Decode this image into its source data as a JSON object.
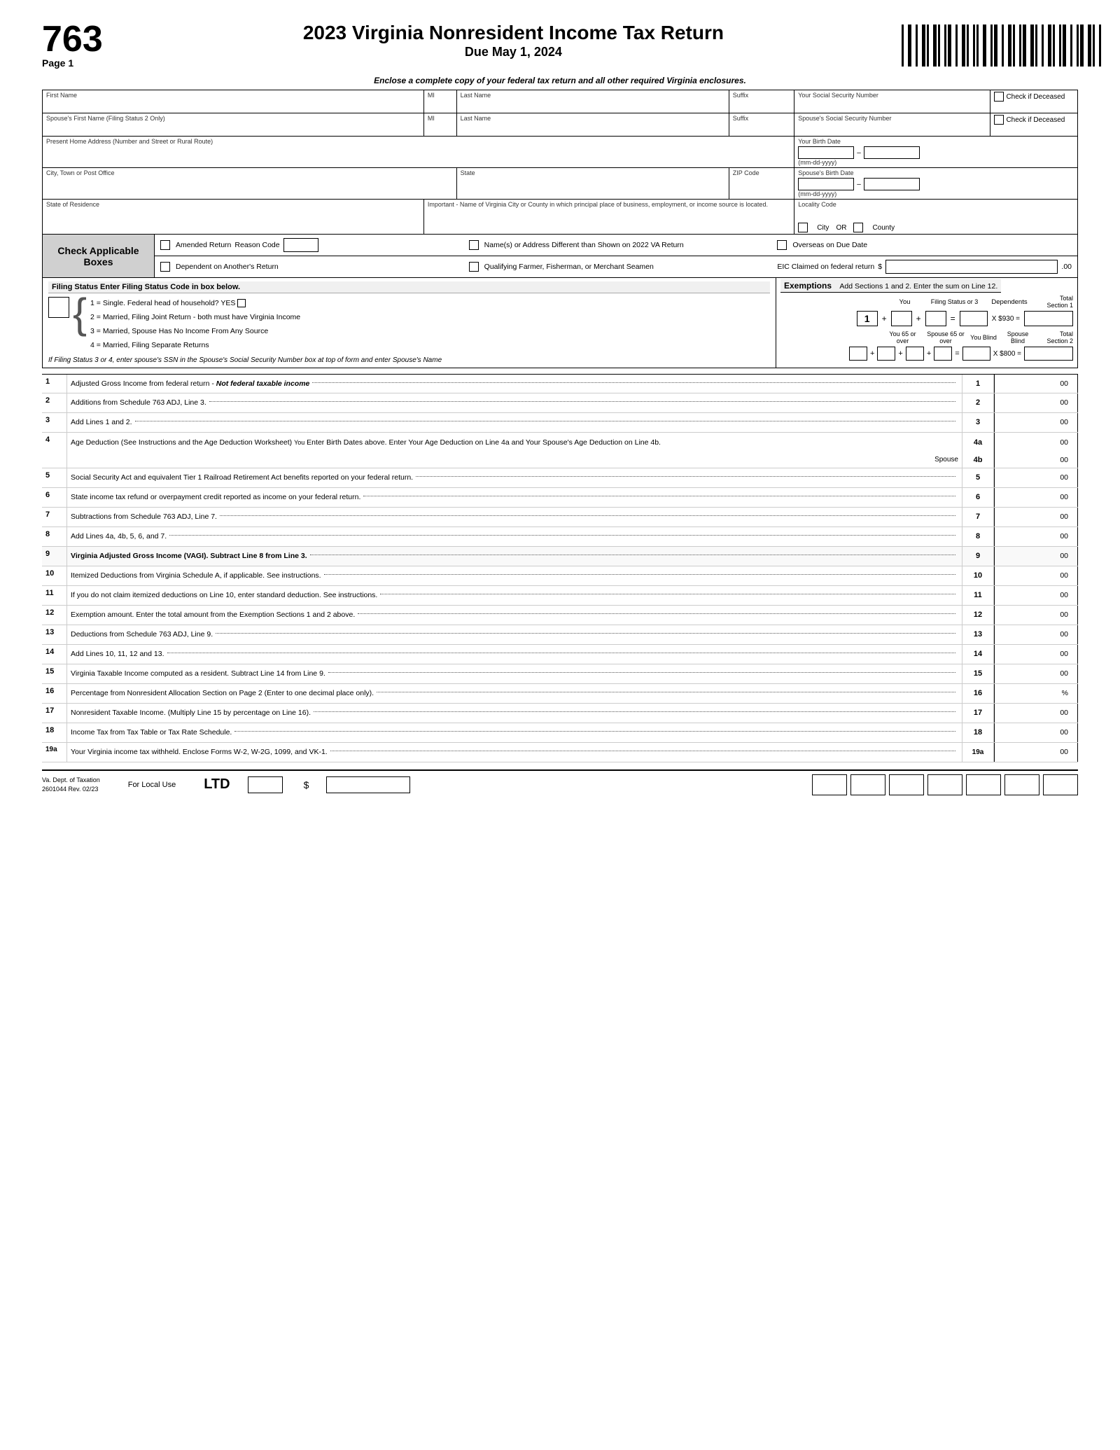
{
  "header": {
    "form_number": "763",
    "page": "Page 1",
    "title": "2023 Virginia Nonresident Income Tax Return",
    "due_date": "Due May 1, 2024"
  },
  "enclose_text": "Enclose a complete copy of your federal tax return and all other required Virginia enclosures.",
  "personal_info": {
    "first_name_label": "First Name",
    "mi_label": "MI",
    "last_name_label": "Last Name",
    "suffix_label": "Suffix",
    "ssn_label": "Your Social Security Number",
    "check_deceased_label": "Check if Deceased",
    "spouse_first_name_label": "Spouse's First Name (Filing Status 2 Only)",
    "spouse_last_name_label": "Last Name",
    "spouse_suffix_label": "Suffix",
    "spouse_ssn_label": "Spouse's Social Security Number",
    "spouse_check_deceased_label": "Check if Deceased",
    "address_label": "Present Home Address (Number and Street or Rural Route)",
    "birth_date_label": "Your Birth Date",
    "birth_date_format": "(mm-dd-yyyy)",
    "city_label": "City, Town or Post Office",
    "state_label": "State",
    "zip_label": "ZIP Code",
    "spouse_birth_date_label": "Spouse's Birth Date",
    "spouse_birth_date_format": "(mm-dd-yyyy)",
    "residence_label": "State of Residence",
    "virginia_locality_label": "Important - Name of Virginia City or County in which principal place of business, employment, or income source is located.",
    "locality_code_label": "Locality Code",
    "city_label2": "City",
    "or_label": "OR",
    "county_label": "County"
  },
  "check_applicable": {
    "title": "Check Applicable Boxes",
    "amended_return_label": "Amended Return",
    "reason_code_label": "Reason Code",
    "name_address_diff_label": "Name(s) or Address Different than Shown on 2022 VA Return",
    "overseas_label": "Overseas on Due Date",
    "dependent_label": "Dependent on Another's Return",
    "qualifying_farmer_label": "Qualifying Farmer, Fisherman, or Merchant Seamen",
    "eic_label": "EIC Claimed on federal return",
    "eic_dollar": "$",
    "eic_cents": ".00"
  },
  "filing_status": {
    "header": "Filing Status Enter Filing Status Code in box below.",
    "option1": "1 = Single. Federal head of household? YES",
    "option2": "2 = Married, Filing Joint Return - both must have Virginia Income",
    "option3": "3 = Married, Spouse Has No Income From Any Source",
    "option4": "4 = Married, Filing Separate Returns",
    "ssn_note": "If Filing Status 3 or 4, enter spouse's SSN in the Spouse's Social Security Number box at top of form and enter Spouse's Name"
  },
  "exemptions": {
    "header": "Exemptions",
    "subtitle": "Add Sections 1 and 2. Enter the sum on Line 12.",
    "section1_label": "Total Section 1",
    "section2_label": "Total Section 2",
    "you_label": "You",
    "filing_status_label": "Filing Status or 3",
    "dependents_label": "Dependents",
    "value1": "1",
    "plus_sign": "+",
    "equals_sign": "=",
    "multiply1": "X $930 =",
    "you_65_label": "You 65 or over",
    "spouse_65_label": "Spouse 65 or over",
    "you_blind_label": "You Blind",
    "spouse_blind_label": "Spouse Blind",
    "multiply2": "X $800 ="
  },
  "lines": [
    {
      "num": "1",
      "desc": "Adjusted Gross Income from federal return - ",
      "desc_italic": "Not federal taxable income",
      "dots": true,
      "ref": "1",
      "cents": "00",
      "bold": false
    },
    {
      "num": "2",
      "desc": "Additions from Schedule 763 ADJ, Line 3.",
      "dots": true,
      "ref": "2",
      "cents": "00",
      "bold": false
    },
    {
      "num": "3",
      "desc": "Add Lines 1 and 2.",
      "dots": true,
      "ref": "3",
      "cents": "00",
      "bold": false
    },
    {
      "num": "4",
      "desc": "Age Deduction (See Instructions and the Age Deduction Worksheet)",
      "desc_suffix": " You Enter Birth Dates above. Enter Your Age Deduction on Line 4a and Your Spouse's Age Deduction on Line 4b.",
      "desc_label_a": "4a",
      "desc_label_b": "Spouse",
      "ref": "4a",
      "ref_b": "4b",
      "cents": "00",
      "cents_b": "00",
      "multiline": true,
      "bold": false
    },
    {
      "num": "5",
      "desc": "Social Security Act and equivalent Tier 1 Railroad Retirement Act benefits reported on your federal return.",
      "dots": true,
      "ref": "5",
      "cents": "00",
      "bold": false
    },
    {
      "num": "6",
      "desc": "State income tax refund or overpayment credit reported as income on your federal return.",
      "dots": true,
      "ref": "6",
      "cents": "00",
      "bold": false
    },
    {
      "num": "7",
      "desc": "Subtractions from Schedule 763 ADJ, Line 7.",
      "dots": true,
      "ref": "7",
      "cents": "00",
      "bold": false
    },
    {
      "num": "8",
      "desc": "Add Lines 4a, 4b, 5, 6, and 7.",
      "dots": true,
      "ref": "8",
      "cents": "00",
      "bold": false
    },
    {
      "num": "9",
      "desc": "Virginia Adjusted Gross Income (VAGI). Subtract Line 8 from Line 3.",
      "dots": true,
      "ref": "9",
      "cents": "00",
      "bold": true
    },
    {
      "num": "10",
      "desc": "Itemized Deductions from Virginia Schedule A, if applicable. See instructions.",
      "dots": true,
      "ref": "10",
      "cents": "00",
      "bold": false
    },
    {
      "num": "11",
      "desc": "If you do not claim itemized deductions on Line 10, enter standard deduction. See instructions.",
      "dots": true,
      "ref": "11",
      "cents": "00",
      "bold": false
    },
    {
      "num": "12",
      "desc": "Exemption amount. Enter the total amount from the Exemption Sections 1 and 2 above.",
      "dots": true,
      "ref": "12",
      "cents": "00",
      "bold": false
    },
    {
      "num": "13",
      "desc": "Deductions from Schedule 763 ADJ, Line 9.",
      "dots": true,
      "ref": "13",
      "cents": "00",
      "bold": false
    },
    {
      "num": "14",
      "desc": "Add Lines 10, 11, 12 and 13.",
      "dots": true,
      "ref": "14",
      "cents": "00",
      "bold": false
    },
    {
      "num": "15",
      "desc": "Virginia Taxable Income computed as a resident. Subtract Line 14 from Line 9.",
      "dots": true,
      "ref": "15",
      "cents": "00",
      "bold": false
    },
    {
      "num": "16",
      "desc": "Percentage from Nonresident Allocation Section on Page 2 (Enter to one decimal place only).",
      "dots": true,
      "ref": "16",
      "cents": "%",
      "bold": false
    },
    {
      "num": "17",
      "desc": "Nonresident Taxable Income. (Multiply Line 15 by percentage on Line 16).",
      "dots": true,
      "ref": "17",
      "cents": "00",
      "bold": false
    },
    {
      "num": "18",
      "desc": "Income Tax from Tax Table or Tax Rate Schedule.",
      "dots": true,
      "ref": "18",
      "cents": "00",
      "bold": false
    },
    {
      "num": "19a",
      "desc": "Your Virginia income tax withheld. Enclose Forms W-2, W-2G, 1099, and VK-1.",
      "dots": true,
      "ref": "19a",
      "cents": "00",
      "bold": false
    }
  ],
  "footer": {
    "dept": "Va. Dept. of Taxation",
    "form_code": "2601044  Rev. 02/23",
    "for_local_use": "For Local Use",
    "ltd_label": "LTD",
    "dollar_sign": "$"
  }
}
